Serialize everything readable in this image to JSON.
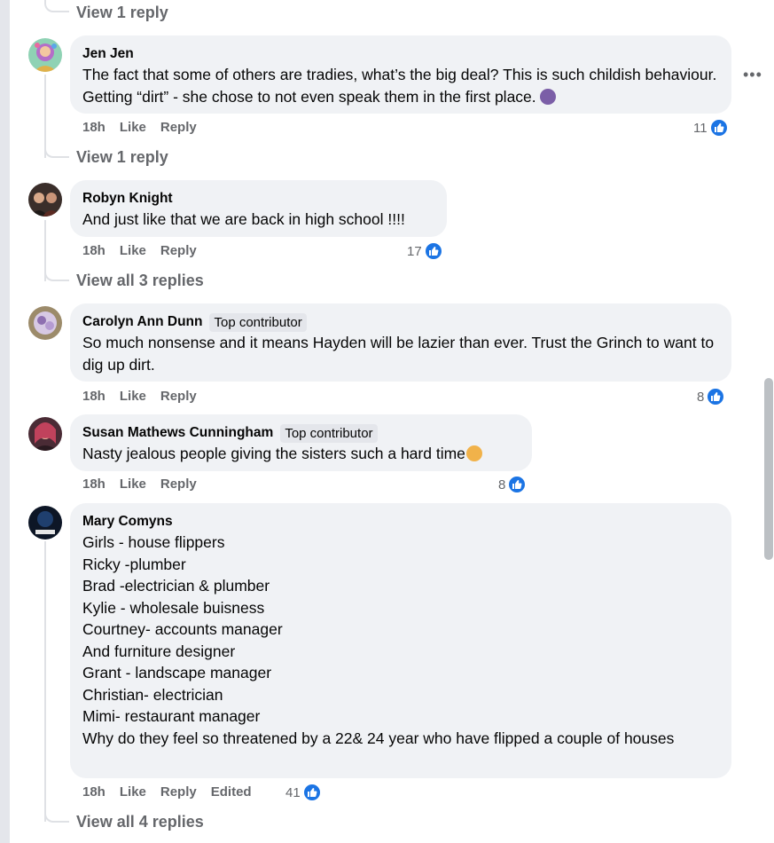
{
  "top": {
    "view_replies": "View 1 reply"
  },
  "colors": {
    "like_blue": "#1b74e4",
    "bubble": "#f0f2f5",
    "meta_gray": "#65676b"
  },
  "comments": [
    {
      "author": "Jen Jen",
      "badge": "",
      "text": "The fact that some of others are tradies, what’s the big deal? This is such childish behaviour. Getting “dirt” - she chose to not even speak them in the first place.",
      "emoji": "woman-facepalming-emoji",
      "time": "18h",
      "like": "Like",
      "reply": "Reply",
      "edited": "",
      "reactions": "11",
      "view_replies": "View 1 reply"
    },
    {
      "author": "Robyn Knight",
      "badge": "",
      "text": "And just like that we are back in high school !!!!",
      "time": "18h",
      "like": "Like",
      "reply": "Reply",
      "edited": "",
      "reactions": "17",
      "view_replies": "View all 3 replies"
    },
    {
      "author": "Carolyn Ann Dunn",
      "badge": "Top contributor",
      "text": "So much nonsense and it means Hayden will be lazier than ever. Trust the Grinch to want to dig up dirt.",
      "time": "18h",
      "like": "Like",
      "reply": "Reply",
      "edited": "",
      "reactions": "8",
      "view_replies": ""
    },
    {
      "author": "Susan Mathews Cunningham",
      "badge": "Top contributor",
      "text": "Nasty jealous people giving the sisters such a hard time",
      "emoji": "person-gesturing-no-emoji",
      "time": "18h",
      "like": "Like",
      "reply": "Reply",
      "edited": "",
      "reactions": "8",
      "view_replies": ""
    },
    {
      "author": "Mary Comyns",
      "badge": "",
      "text": "Girls - house flippers\nRicky -plumber\nBrad -electrician & plumber\nKylie - wholesale buisness\nCourtney- accounts manager\nAnd furniture designer\nGrant - landscape manager\nChristian- electrician\nMimi- restaurant manager\nWhy do they feel so threatened by a 22& 24 year who have flipped a couple of houses",
      "time": "18h",
      "like": "Like",
      "reply": "Reply",
      "edited": "Edited",
      "reactions": "41",
      "view_replies": "View all 4 replies"
    }
  ]
}
